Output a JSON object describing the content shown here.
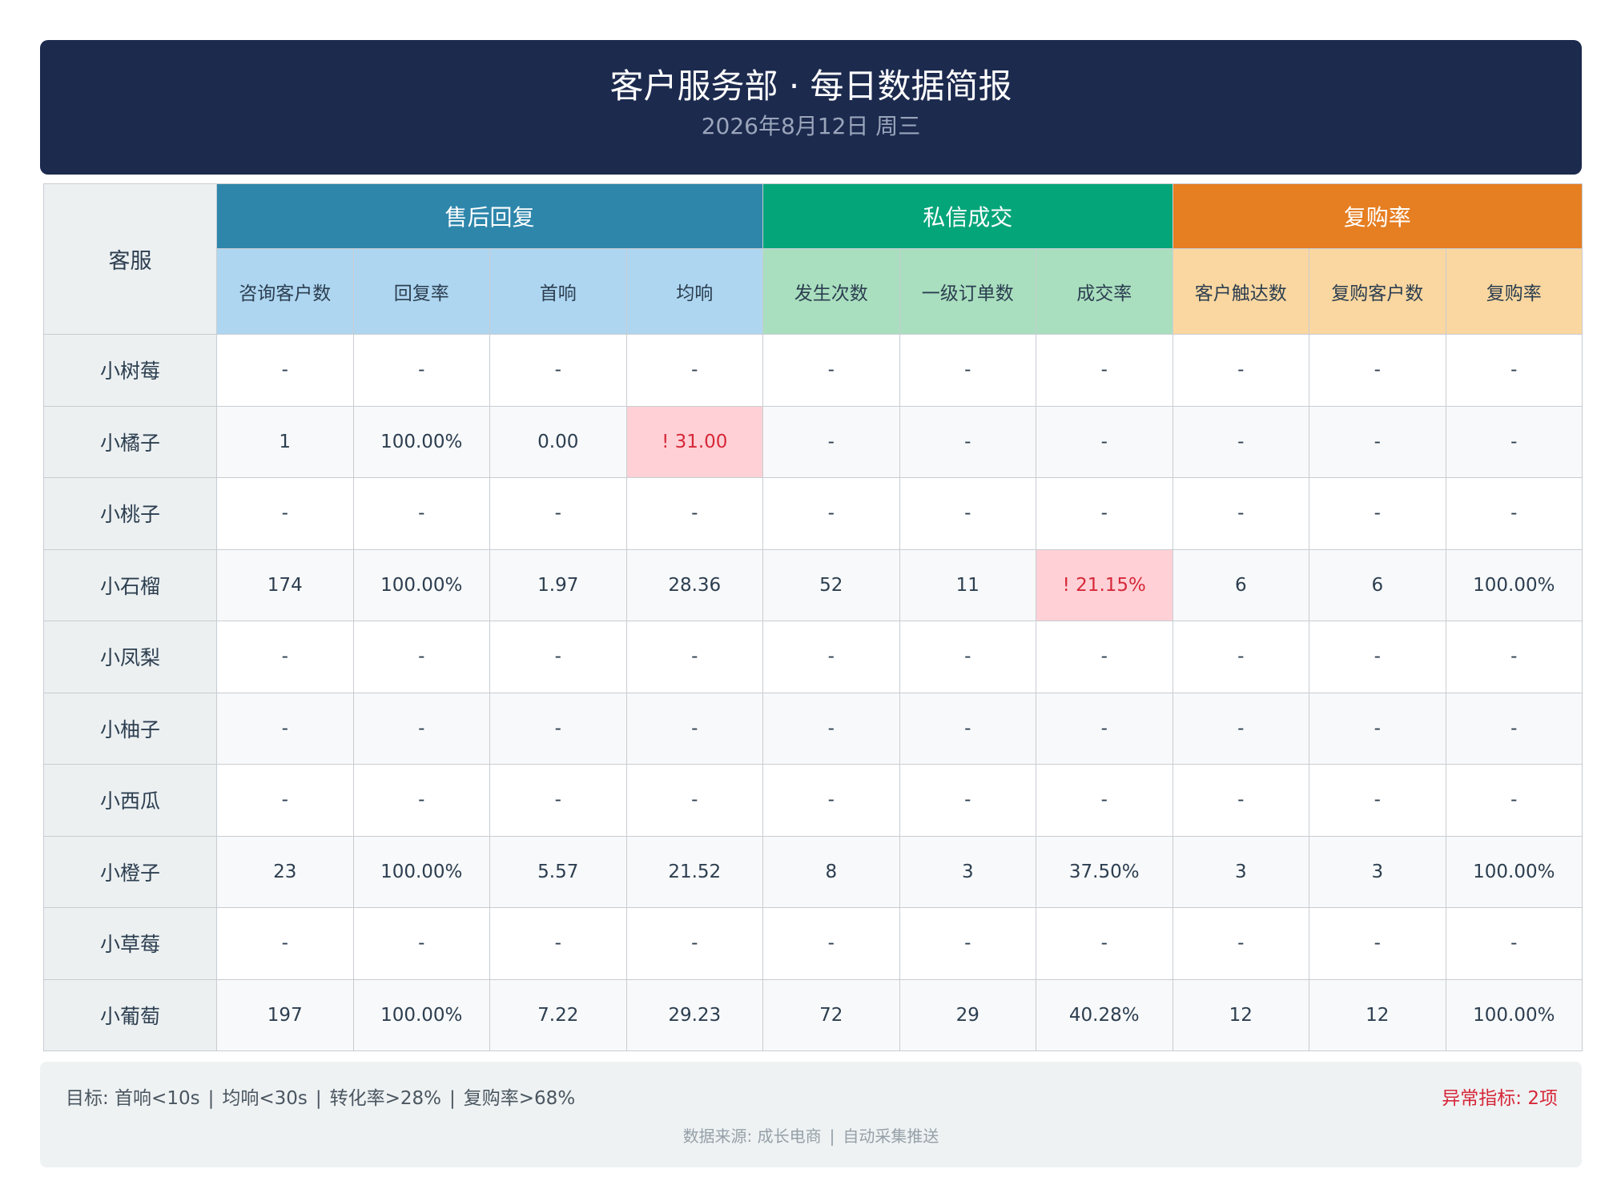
{
  "header": {
    "title": "客户服务部 · 每日数据简报",
    "date": "2026年8月12日 周三"
  },
  "table": {
    "agent_header": "客服",
    "groups": [
      {
        "label": "售后回复",
        "color": "#2e86ab"
      },
      {
        "label": "私信成交",
        "color": "#05a57a"
      },
      {
        "label": "复购率",
        "color": "#e67e22"
      }
    ],
    "columns": [
      "咨询客户数",
      "回复率",
      "首响",
      "均响",
      "发生次数",
      "一级订单数",
      "成交率",
      "客户触达数",
      "复购客户数",
      "复购率"
    ],
    "rows": [
      {
        "agent": "小树莓",
        "cells": [
          "-",
          "-",
          "-",
          "-",
          "-",
          "-",
          "-",
          "-",
          "-",
          "-"
        ]
      },
      {
        "agent": "小橘子",
        "cells": [
          "1",
          "100.00%",
          "0.00",
          "! 31.00",
          "-",
          "-",
          "-",
          "-",
          "-",
          "-"
        ]
      },
      {
        "agent": "小桃子",
        "cells": [
          "-",
          "-",
          "-",
          "-",
          "-",
          "-",
          "-",
          "-",
          "-",
          "-"
        ]
      },
      {
        "agent": "小石榴",
        "cells": [
          "174",
          "100.00%",
          "1.97",
          "28.36",
          "52",
          "11",
          "! 21.15%",
          "6",
          "6",
          "100.00%"
        ]
      },
      {
        "agent": "小凤梨",
        "cells": [
          "-",
          "-",
          "-",
          "-",
          "-",
          "-",
          "-",
          "-",
          "-",
          "-"
        ]
      },
      {
        "agent": "小柚子",
        "cells": [
          "-",
          "-",
          "-",
          "-",
          "-",
          "-",
          "-",
          "-",
          "-",
          "-"
        ]
      },
      {
        "agent": "小西瓜",
        "cells": [
          "-",
          "-",
          "-",
          "-",
          "-",
          "-",
          "-",
          "-",
          "-",
          "-"
        ]
      },
      {
        "agent": "小橙子",
        "cells": [
          "23",
          "100.00%",
          "5.57",
          "21.52",
          "8",
          "3",
          "37.50%",
          "3",
          "3",
          "100.00%"
        ]
      },
      {
        "agent": "小草莓",
        "cells": [
          "-",
          "-",
          "-",
          "-",
          "-",
          "-",
          "-",
          "-",
          "-",
          "-"
        ]
      },
      {
        "agent": "小葡萄",
        "cells": [
          "197",
          "100.00%",
          "7.22",
          "29.23",
          "72",
          "29",
          "40.28%",
          "12",
          "12",
          "100.00%"
        ]
      }
    ]
  },
  "footer": {
    "targets": [
      "目标: 首响<10s",
      "均响<30s",
      "转化率>28%",
      "复购率>68%"
    ],
    "anomaly": "异常指标: 2项",
    "source": [
      "数据来源: 成长电商",
      "自动采集推送"
    ]
  },
  "colors": {
    "header_bg": "#1c2a4e",
    "alert_bg": "#ffd1d6",
    "alert_text": "#d62839"
  }
}
